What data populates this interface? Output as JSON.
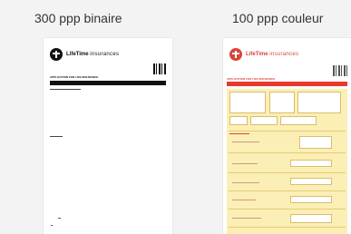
{
  "left_panel": {
    "caption": "300 ppp binaire",
    "document": {
      "brand": "LifeTime",
      "brand_sub": "insurances",
      "form_title": "APPLICATION FOR LIFE INSURANCE"
    }
  },
  "right_panel": {
    "caption": "100 ppp couleur",
    "document": {
      "brand": "LifeTime",
      "brand_sub": "insurances",
      "form_title": "APPLICATION FOR LIFE INSURANCE"
    }
  },
  "colors": {
    "background": "#f3f3f3",
    "bw_ink": "#111111",
    "brand_red": "#d8453a",
    "form_yellow": "#fbefb5"
  }
}
